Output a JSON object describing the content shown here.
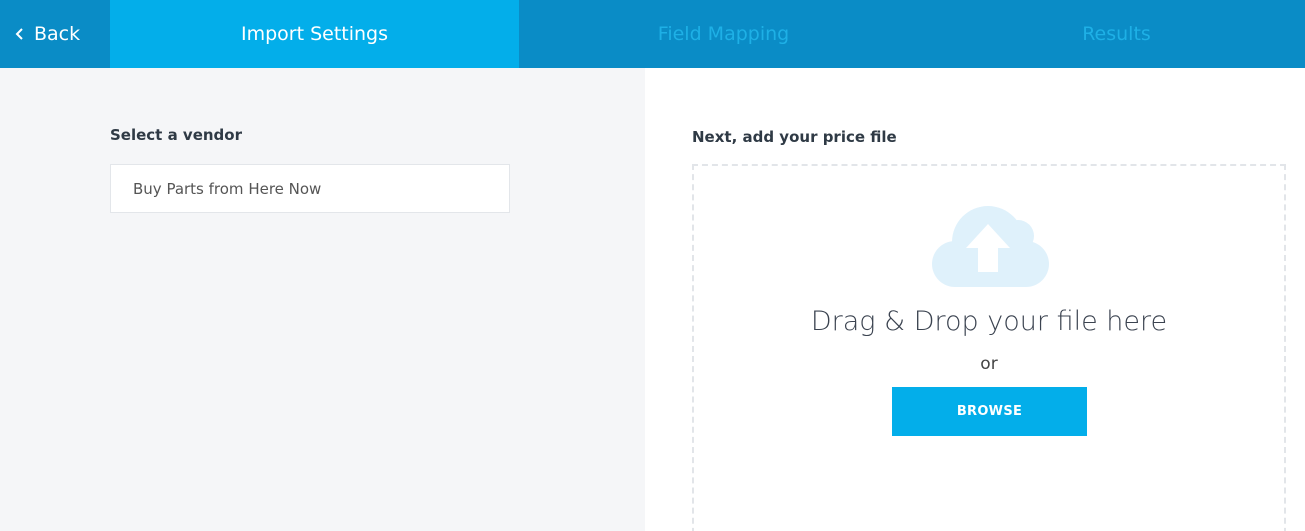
{
  "nav": {
    "back_label": "Back",
    "steps": [
      {
        "label": "Import Settings",
        "state": "active"
      },
      {
        "label": "Field Mapping",
        "state": "inactive"
      },
      {
        "label": "Results",
        "state": "inactive"
      }
    ]
  },
  "vendor": {
    "label": "Select a vendor",
    "value": "Buy Parts from Here Now"
  },
  "upload": {
    "label": "Next, add your price file",
    "drop_text": "Drag & Drop your file here",
    "or_text": "or",
    "browse_label": "BROWSE",
    "icon": "cloud-upload-icon"
  },
  "colors": {
    "header": "#0a8cc6",
    "accent": "#03aeea",
    "inactive_step_text": "#1eb0e6",
    "cloud": "#dff1fb"
  }
}
